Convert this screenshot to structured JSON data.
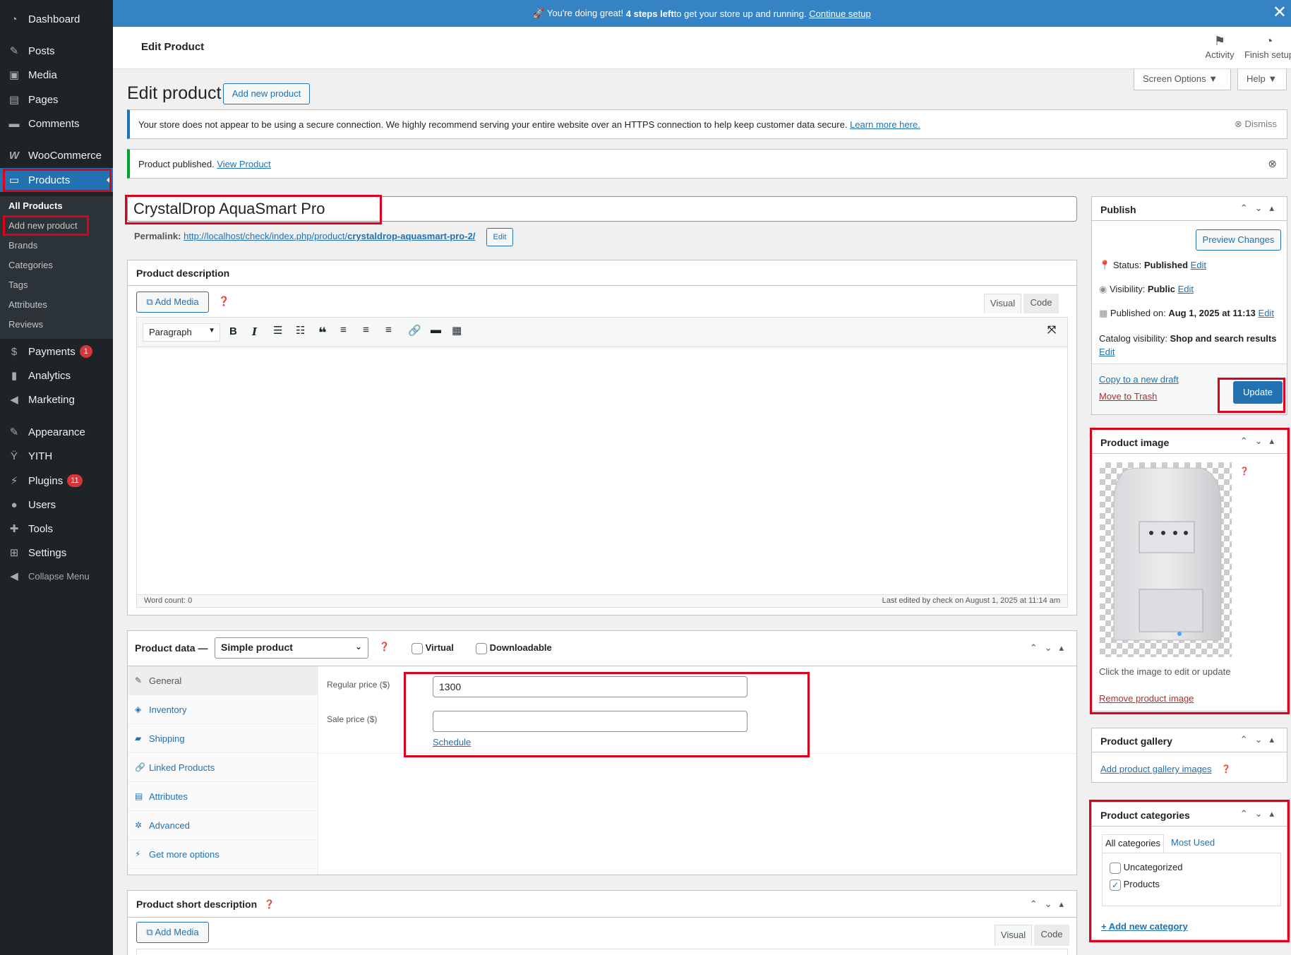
{
  "sidebar": {
    "items": [
      {
        "label": "Dashboard",
        "icon": "dashboard-icon"
      },
      {
        "label": "Posts",
        "icon": "pin-icon"
      },
      {
        "label": "Media",
        "icon": "media-icon"
      },
      {
        "label": "Pages",
        "icon": "pages-icon"
      },
      {
        "label": "Comments",
        "icon": "comments-icon"
      },
      {
        "label": "WooCommerce",
        "icon": "woocommerce-icon"
      },
      {
        "label": "Products",
        "icon": "products-icon"
      },
      {
        "label": "Payments",
        "icon": "payments-icon",
        "badge": "1"
      },
      {
        "label": "Analytics",
        "icon": "analytics-icon"
      },
      {
        "label": "Marketing",
        "icon": "megaphone-icon"
      },
      {
        "label": "Appearance",
        "icon": "brush-icon"
      },
      {
        "label": "YITH",
        "icon": "yith-icon"
      },
      {
        "label": "Plugins",
        "icon": "plugins-icon",
        "badge": "11"
      },
      {
        "label": "Users",
        "icon": "users-icon"
      },
      {
        "label": "Tools",
        "icon": "wrench-icon"
      },
      {
        "label": "Settings",
        "icon": "settings-icon"
      },
      {
        "label": "Collapse Menu",
        "icon": "collapse-icon"
      }
    ],
    "submenu": [
      "All Products",
      "Add new product",
      "Brands",
      "Categories",
      "Tags",
      "Attributes",
      "Reviews"
    ]
  },
  "topbar": {
    "prefix": "🚀 You're doing great! ",
    "steps": "4 steps left",
    "middle": " to get your store up and running. ",
    "link": "Continue setup"
  },
  "header": {
    "title": "Edit Product",
    "activity": "Activity",
    "finish_setup": "Finish setup",
    "screen_options": "Screen Options ▼",
    "help": "Help ▼"
  },
  "page": {
    "title": "Edit product",
    "add_new": "Add new product"
  },
  "notices": {
    "https_text": "Your store does not appear to be using a secure connection. We highly recommend serving your entire website over an HTTPS connection to help keep customer data secure. ",
    "https_link": "Learn more here.",
    "dismiss": "Dismiss",
    "published_text": "Product published. ",
    "published_link": "View Product"
  },
  "product": {
    "title": "CrystalDrop AquaSmart Pro",
    "permalink_label": "Permalink:",
    "permalink_base": "http://localhost/check/index.php/product/",
    "permalink_slug": "crystaldrop-aquasmart-pro-2/",
    "permalink_edit": "Edit"
  },
  "description": {
    "title": "Product description",
    "add_media": "Add Media",
    "tab_visual": "Visual",
    "tab_code": "Code",
    "format": "Paragraph",
    "word_count": "Word count: 0",
    "last_edited": "Last edited by check on August 1, 2025 at 11:14 am"
  },
  "product_data": {
    "title": "Product data —",
    "type": "Simple product",
    "virtual": "Virtual",
    "downloadable": "Downloadable",
    "tabs": [
      "General",
      "Inventory",
      "Shipping",
      "Linked Products",
      "Attributes",
      "Advanced",
      "Get more options"
    ],
    "regular_price_label": "Regular price ($)",
    "regular_price": "1300",
    "sale_price_label": "Sale price ($)",
    "sale_price": "",
    "schedule": "Schedule"
  },
  "short_description": {
    "title": "Product short description",
    "add_media": "Add Media",
    "tab_visual": "Visual",
    "tab_code": "Code"
  },
  "publish": {
    "title": "Publish",
    "preview": "Preview Changes",
    "status_label": "Status: ",
    "status": "Published",
    "visibility_label": "Visibility: ",
    "visibility": "Public",
    "published_label": "Published on: ",
    "published": "Aug 1, 2025 at 11:13",
    "catalog_label": "Catalog visibility: ",
    "catalog": "Shop and search results",
    "edit": "Edit",
    "copy_draft": "Copy to a new draft",
    "trash": "Move to Trash",
    "update": "Update"
  },
  "product_image": {
    "title": "Product image",
    "hint": "Click the image to edit or update",
    "remove": "Remove product image"
  },
  "gallery": {
    "title": "Product gallery",
    "add": "Add product gallery images"
  },
  "categories": {
    "title": "Product categories",
    "tab_all": "All categories",
    "tab_most": "Most Used",
    "items": [
      {
        "label": "Uncategorized",
        "checked": false
      },
      {
        "label": "Products",
        "checked": true
      }
    ],
    "add_new": "+ Add new category"
  },
  "colors": {
    "accent": "#2271b1",
    "sidebar": "#1d2327",
    "annotation": "#e0001b",
    "danger": "#d63638"
  }
}
